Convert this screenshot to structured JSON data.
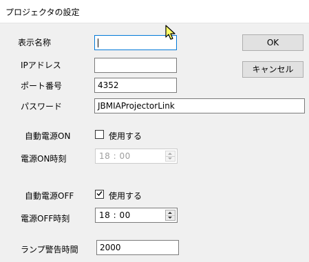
{
  "window": {
    "title": "プロジェクタの設定"
  },
  "fields": {
    "display_name": {
      "label": "表示名称",
      "value": ""
    },
    "ip_address": {
      "label": "IPアドレス",
      "value": ""
    },
    "port_number": {
      "label": "ポート番号",
      "value": "4352"
    },
    "password": {
      "label": "パスワード",
      "value": "JBMIAProjectorLink"
    }
  },
  "buttons": {
    "ok": "OK",
    "cancel": "キャンセル"
  },
  "auto_power_on": {
    "label": "自動電源ON",
    "checkbox_label": "使用する",
    "checked": false,
    "time_label": "電源ON時刻",
    "time_value": "18 : 00",
    "time_enabled": false
  },
  "auto_power_off": {
    "label": "自動電源OFF",
    "checkbox_label": "使用する",
    "checked": true,
    "time_label": "電源OFF時刻",
    "time_value": "18 : 00",
    "time_enabled": true
  },
  "lamp_warning": {
    "label": "ランプ警告時間",
    "value": "2000"
  },
  "icons": [
    "checkmark-icon",
    "spin-up-icon",
    "spin-down-icon",
    "mouse-cursor-icon"
  ],
  "colors": {
    "focus_border": "#0078d7",
    "dialog_background": "#f0f0f0",
    "cursor_fill": "#ffff66"
  }
}
